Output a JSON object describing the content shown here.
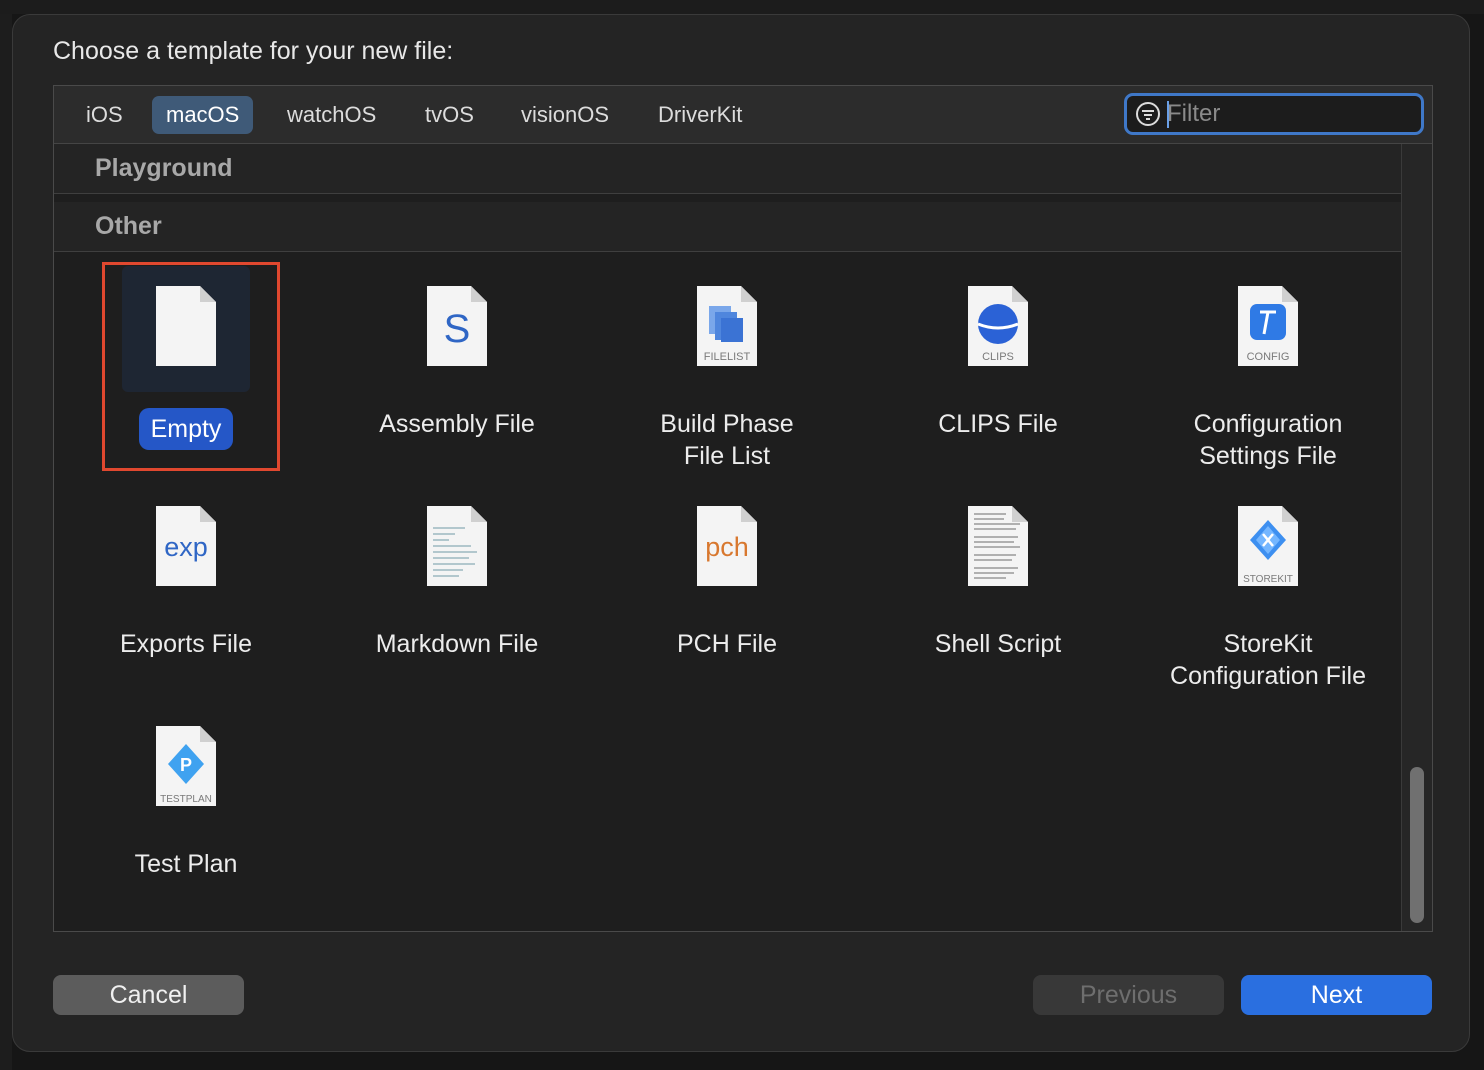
{
  "dialog": {
    "title": "Choose a template for your new file:"
  },
  "platform_tabs": [
    {
      "label": "iOS",
      "selected": false
    },
    {
      "label": "macOS",
      "selected": true
    },
    {
      "label": "watchOS",
      "selected": false
    },
    {
      "label": "tvOS",
      "selected": false
    },
    {
      "label": "visionOS",
      "selected": false
    },
    {
      "label": "DriverKit",
      "selected": false
    }
  ],
  "filter": {
    "placeholder": "Filter",
    "value": ""
  },
  "sections": [
    {
      "label": "Playground"
    },
    {
      "label": "Other"
    }
  ],
  "templates": [
    {
      "label": "Empty",
      "icon": "empty-file-icon",
      "selected": true
    },
    {
      "label": "Assembly File",
      "icon": "assembly-file-icon",
      "badge": "S"
    },
    {
      "label": "Build Phase File List",
      "line1": "Build Phase",
      "line2": "File List",
      "icon": "filelist-icon",
      "badge": "FILELIST"
    },
    {
      "label": "CLIPS File",
      "icon": "clips-file-icon",
      "badge": "CLIPS"
    },
    {
      "label": "Configuration Settings File",
      "line1": "Configuration",
      "line2": "Settings File",
      "icon": "config-file-icon",
      "badge": "CONFIG"
    },
    {
      "label": "Exports File",
      "icon": "exports-file-icon",
      "badge": "exp"
    },
    {
      "label": "Markdown File",
      "icon": "markdown-file-icon"
    },
    {
      "label": "PCH File",
      "icon": "pch-file-icon",
      "badge": "pch"
    },
    {
      "label": "Shell Script",
      "icon": "shell-script-icon"
    },
    {
      "label": "StoreKit Configuration File",
      "line1": "StoreKit",
      "line2": "Configuration File",
      "icon": "storekit-icon",
      "badge": "STOREKIT"
    },
    {
      "label": "Test Plan",
      "icon": "testplan-icon",
      "badge": "TESTPLAN"
    }
  ],
  "buttons": {
    "cancel": "Cancel",
    "previous": "Previous",
    "next": "Next"
  },
  "colors": {
    "accent": "#2a6fe0",
    "selection_pill": "#2557c7",
    "highlight_box": "#e0482f",
    "active_tab": "#3f5a78"
  }
}
